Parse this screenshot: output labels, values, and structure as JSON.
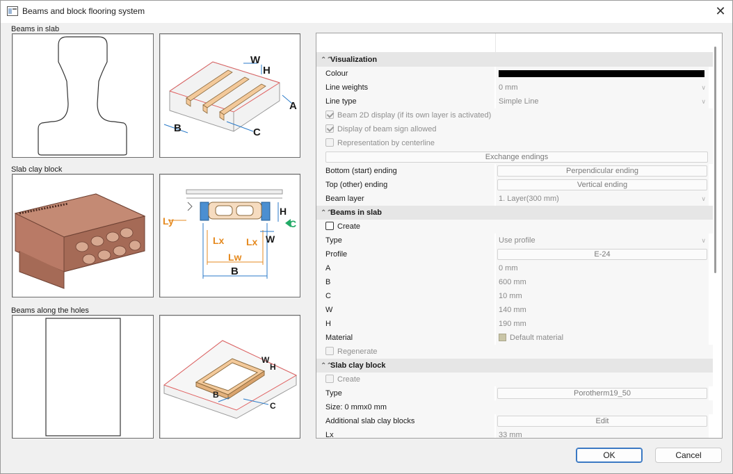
{
  "window": {
    "title": "Beams and block flooring system",
    "close_glyph": "✕"
  },
  "left": {
    "beams_in_slab": "Beams in slab",
    "slab_clay_block": "Slab clay block",
    "beams_along_holes": "Beams along the holes",
    "diagram1": {
      "w": "W",
      "h": "H",
      "a": "A",
      "b": "B",
      "c": "C"
    },
    "diagram2": {
      "ly": "Ly",
      "lx": "Lx",
      "lx2": "Lx",
      "lw": "Lw",
      "b": "B",
      "h": "H",
      "c": "C",
      "w": "W"
    },
    "diagram3": {
      "w": "W",
      "h": "H",
      "b": "B",
      "c": "C"
    }
  },
  "grid": {
    "visualization": {
      "title": "Visualization",
      "colour_label": "Colour",
      "line_weights_label": "Line weights",
      "line_weights_value": "0 mm",
      "line_type_label": "Line type",
      "line_type_value": "Simple Line",
      "beam2d_label": "Beam 2D display (if its own layer is activated)",
      "beam_sign_label": "Display of beam sign allowed",
      "centerline_label": "Representation by centerline",
      "exchange_label": "Exchange endings",
      "bottom_label": "Bottom (start) ending",
      "bottom_value": "Perpendicular ending",
      "top_label": "Top (other) ending",
      "top_value": "Vertical ending",
      "layer_label": "Beam layer",
      "layer_value": "1. Layer(300 mm)"
    },
    "beams": {
      "title": "Beams in slab",
      "create_label": "Create",
      "type_label": "Type",
      "type_value": "Use profile",
      "profile_label": "Profile",
      "profile_value": "E-24",
      "a_label": "A",
      "a_value": "0 mm",
      "b_label": "B",
      "b_value": "600 mm",
      "c_label": "C",
      "c_value": "10 mm",
      "w_label": "W",
      "w_value": "140 mm",
      "h_label": "H",
      "h_value": "190 mm",
      "material_label": "Material",
      "material_value": "Default material",
      "regenerate_label": "Regenerate"
    },
    "clay": {
      "title": "Slab clay block",
      "create_label": "Create",
      "type_label": "Type",
      "type_value": "Porotherm19_50",
      "size_label": "Size: 0 mmx0 mm",
      "additional_label": "Additional slab clay blocks",
      "additional_value": "Edit",
      "lx_label": "Lx",
      "lx_value": "33 mm"
    },
    "chevron": "⌃⌃",
    "dropdown_arrow": "∨"
  },
  "buttons": {
    "ok": "OK",
    "cancel": "Cancel"
  },
  "colors": {
    "accent": "#3a78c3",
    "wood": "#f3c99a",
    "clay": "#b97a66",
    "red_edge": "#e06060",
    "blue_dim": "#2a7ac8",
    "orange_dim": "#e58a1f"
  }
}
